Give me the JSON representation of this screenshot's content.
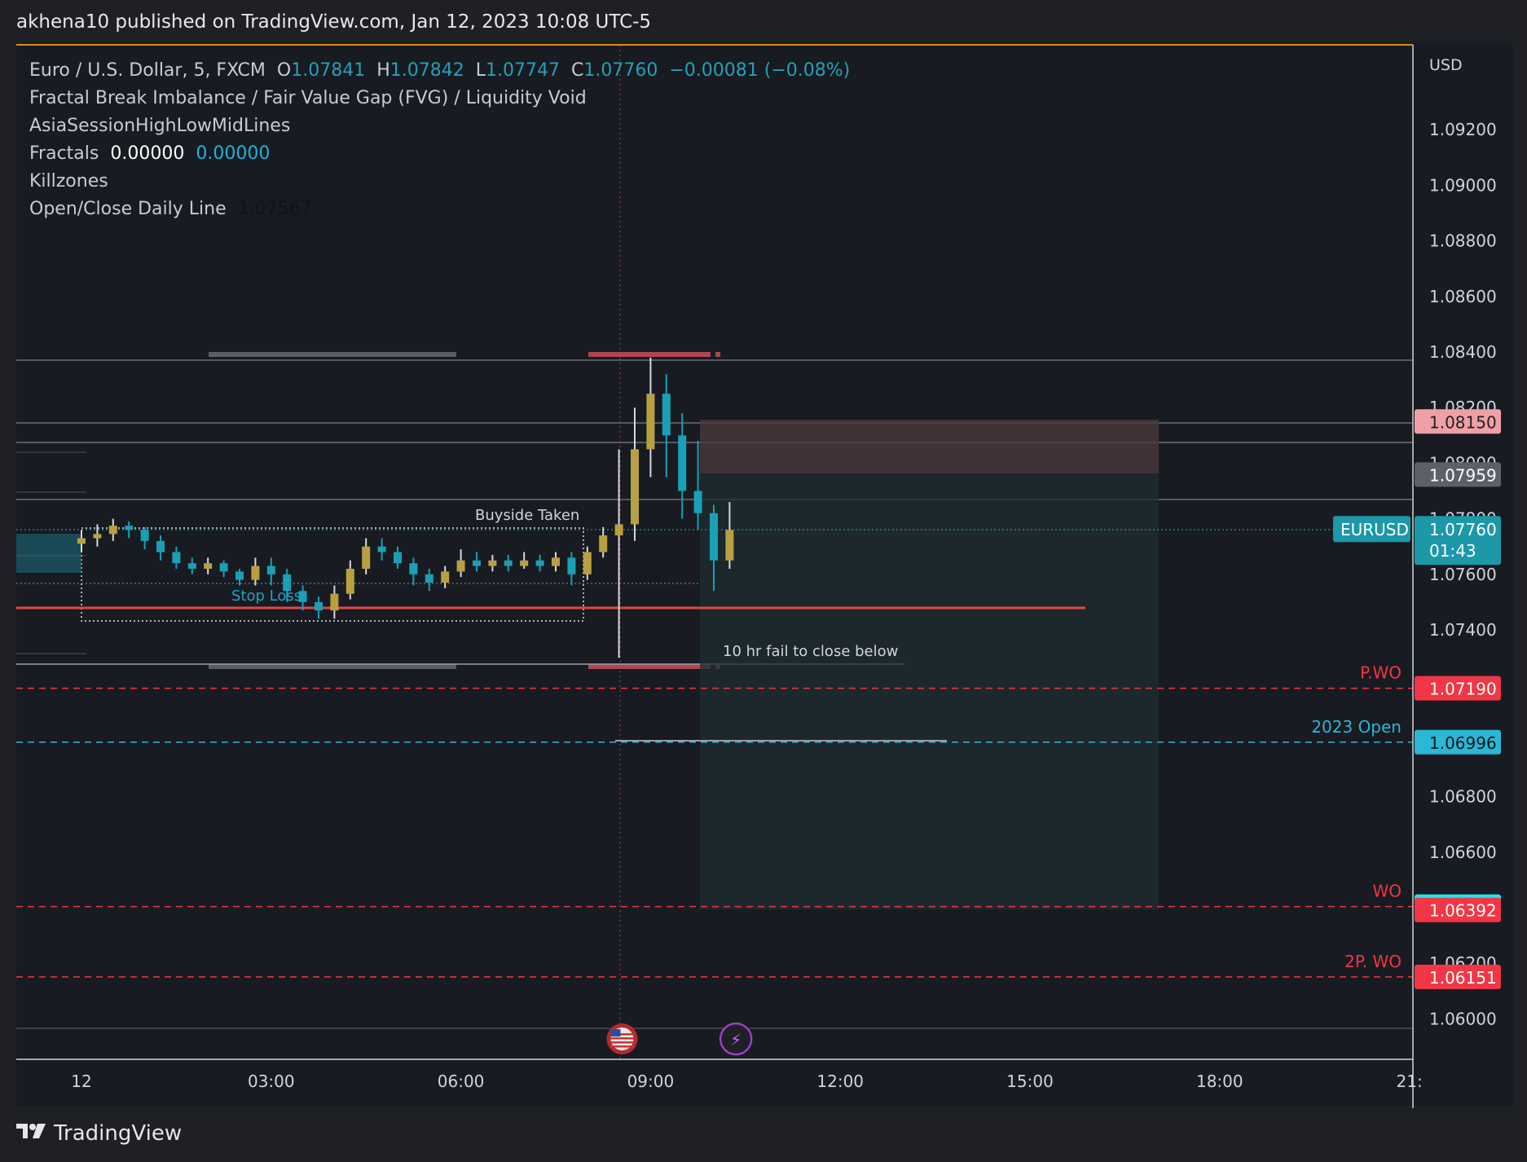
{
  "header": {
    "publish_text": "akhena10 published on TradingView.com, Jan 12, 2023 10:08 UTC-5"
  },
  "legend": {
    "symbol": "Euro / U.S. Dollar, 5, FXCM",
    "o_label": "O",
    "o_value": "1.07841",
    "h_label": "H",
    "h_value": "1.07842",
    "l_label": "L",
    "l_value": "1.07747",
    "c_label": "C",
    "c_value": "1.07760",
    "change": "−0.00081 (−0.08%)",
    "indicator_1": "Fractal Break Imbalance / Fair Value Gap (FVG) / Liquidity Void",
    "indicator_2": "AsiaSessionHighLowMidLines",
    "indicator_3_label": "Fractals",
    "indicator_3_v1": "0.00000",
    "indicator_3_v2": "0.00000",
    "indicator_4": "Killzones",
    "indicator_5_label": "Open/Close Daily Line",
    "indicator_5_value": "1.07567"
  },
  "chart_data": {
    "type": "candlestick",
    "symbol": "EURUSD",
    "interval": "5",
    "currency": "USD",
    "y_range": [
      1.059,
      1.095
    ],
    "x_ticks": [
      {
        "label": "12",
        "hour": 0
      },
      {
        "label": "03:00",
        "hour": 3
      },
      {
        "label": "06:00",
        "hour": 6
      },
      {
        "label": "09:00",
        "hour": 9
      },
      {
        "label": "12:00",
        "hour": 12
      },
      {
        "label": "15:00",
        "hour": 15
      },
      {
        "label": "18:00",
        "hour": 18
      },
      {
        "label": "21:",
        "hour": 21
      }
    ],
    "y_ticks": [
      {
        "label": "1.09200",
        "value": 1.092
      },
      {
        "label": "1.09000",
        "value": 1.09
      },
      {
        "label": "1.08800",
        "value": 1.088
      },
      {
        "label": "1.08600",
        "value": 1.086
      },
      {
        "label": "1.08400",
        "value": 1.084
      },
      {
        "label": "1.08200",
        "value": 1.082
      },
      {
        "label": "1.08000",
        "value": 1.08
      },
      {
        "label": "1.07800",
        "value": 1.078
      },
      {
        "label": "1.07600",
        "value": 1.076
      },
      {
        "label": "1.07400",
        "value": 1.074
      },
      {
        "label": "1.06800",
        "value": 1.068
      },
      {
        "label": "1.06600",
        "value": 1.066
      },
      {
        "label": "1.06200",
        "value": 1.062
      },
      {
        "label": "1.06000",
        "value": 1.06
      }
    ],
    "levels": [
      {
        "label": "P.WO",
        "value": 1.0719,
        "price_label": "1.07190",
        "color": "#f23645",
        "style": "dashed"
      },
      {
        "label": "2023 Open",
        "value": 1.06996,
        "price_label": "1.06996",
        "color": "#2bb7d5",
        "style": "dashed"
      },
      {
        "label": "WO",
        "value": 1.06404,
        "price_label": "1.06404",
        "color": "#f23645",
        "style": "dashed"
      },
      {
        "label": "",
        "value": 1.06392,
        "price_label": "1.06392",
        "color": "#f23645",
        "style": "none"
      },
      {
        "label": "2P. WO",
        "value": 1.06151,
        "price_label": "1.06151",
        "color": "#f23645",
        "style": "dashed"
      }
    ],
    "price_badges": [
      {
        "value": 1.0815,
        "label": "1.08150",
        "bg": "#f0a0a4",
        "fg": "#1e2026"
      },
      {
        "value": 1.07959,
        "label": "1.07959",
        "bg": "#5d6068",
        "fg": "#ffffff"
      }
    ],
    "current": {
      "symbol": "EURUSD",
      "price": "1.07760",
      "countdown": "01:43",
      "value": 1.0776,
      "color": "#1c98a8"
    },
    "annotations": [
      {
        "text": "Buyside Taken"
      },
      {
        "text": "Stop Loss"
      },
      {
        "text": "10 hr fail to close below"
      }
    ],
    "candles": [
      {
        "h": 0.0,
        "o": 1.0771,
        "c": 1.0773,
        "hi": 1.0776,
        "lo": 1.0768
      },
      {
        "h": 0.25,
        "o": 1.0773,
        "c": 1.07745,
        "hi": 1.0778,
        "lo": 1.077
      },
      {
        "h": 0.5,
        "o": 1.07745,
        "c": 1.07775,
        "hi": 1.078,
        "lo": 1.0772
      },
      {
        "h": 0.75,
        "o": 1.07775,
        "c": 1.0776,
        "hi": 1.0779,
        "lo": 1.0773
      },
      {
        "h": 1.0,
        "o": 1.0776,
        "c": 1.0772,
        "hi": 1.0777,
        "lo": 1.0769
      },
      {
        "h": 1.25,
        "o": 1.0772,
        "c": 1.0768,
        "hi": 1.0774,
        "lo": 1.0765
      },
      {
        "h": 1.5,
        "o": 1.0768,
        "c": 1.0764,
        "hi": 1.077,
        "lo": 1.0762
      },
      {
        "h": 1.75,
        "o": 1.0764,
        "c": 1.0762,
        "hi": 1.0766,
        "lo": 1.076
      },
      {
        "h": 2.0,
        "o": 1.0762,
        "c": 1.0764,
        "hi": 1.0766,
        "lo": 1.076
      },
      {
        "h": 2.25,
        "o": 1.0764,
        "c": 1.0761,
        "hi": 1.0765,
        "lo": 1.0759
      },
      {
        "h": 2.5,
        "o": 1.0761,
        "c": 1.0758,
        "hi": 1.0762,
        "lo": 1.0756
      },
      {
        "h": 2.75,
        "o": 1.0758,
        "c": 1.0763,
        "hi": 1.0766,
        "lo": 1.0756
      },
      {
        "h": 3.0,
        "o": 1.0763,
        "c": 1.076,
        "hi": 1.0766,
        "lo": 1.0756
      },
      {
        "h": 3.25,
        "o": 1.076,
        "c": 1.0754,
        "hi": 1.0762,
        "lo": 1.075
      },
      {
        "h": 3.5,
        "o": 1.0754,
        "c": 1.075,
        "hi": 1.0756,
        "lo": 1.0747
      },
      {
        "h": 3.75,
        "o": 1.075,
        "c": 1.0747,
        "hi": 1.0752,
        "lo": 1.0744
      },
      {
        "h": 4.0,
        "o": 1.0747,
        "c": 1.0753,
        "hi": 1.0756,
        "lo": 1.0744
      },
      {
        "h": 4.25,
        "o": 1.0753,
        "c": 1.0762,
        "hi": 1.0765,
        "lo": 1.0751
      },
      {
        "h": 4.5,
        "o": 1.0762,
        "c": 1.077,
        "hi": 1.0773,
        "lo": 1.076
      },
      {
        "h": 4.75,
        "o": 1.077,
        "c": 1.0768,
        "hi": 1.0773,
        "lo": 1.0765
      },
      {
        "h": 5.0,
        "o": 1.0768,
        "c": 1.0764,
        "hi": 1.077,
        "lo": 1.0762
      },
      {
        "h": 5.25,
        "o": 1.0764,
        "c": 1.076,
        "hi": 1.0766,
        "lo": 1.0756
      },
      {
        "h": 5.5,
        "o": 1.076,
        "c": 1.0757,
        "hi": 1.0762,
        "lo": 1.0754
      },
      {
        "h": 5.75,
        "o": 1.0757,
        "c": 1.0761,
        "hi": 1.0763,
        "lo": 1.0755
      },
      {
        "h": 6.0,
        "o": 1.0761,
        "c": 1.0765,
        "hi": 1.0769,
        "lo": 1.0759
      },
      {
        "h": 6.25,
        "o": 1.0765,
        "c": 1.0763,
        "hi": 1.0768,
        "lo": 1.0761
      },
      {
        "h": 6.5,
        "o": 1.0763,
        "c": 1.0765,
        "hi": 1.0767,
        "lo": 1.0761
      },
      {
        "h": 6.75,
        "o": 1.0765,
        "c": 1.0763,
        "hi": 1.0767,
        "lo": 1.0761
      },
      {
        "h": 7.0,
        "o": 1.0763,
        "c": 1.0765,
        "hi": 1.0768,
        "lo": 1.0762
      },
      {
        "h": 7.25,
        "o": 1.0765,
        "c": 1.0763,
        "hi": 1.0767,
        "lo": 1.0761
      },
      {
        "h": 7.5,
        "o": 1.0763,
        "c": 1.0766,
        "hi": 1.0768,
        "lo": 1.0761
      },
      {
        "h": 7.75,
        "o": 1.0766,
        "c": 1.076,
        "hi": 1.0768,
        "lo": 1.0756
      },
      {
        "h": 8.0,
        "o": 1.076,
        "c": 1.0768,
        "hi": 1.077,
        "lo": 1.0758
      },
      {
        "h": 8.25,
        "o": 1.0768,
        "c": 1.0774,
        "hi": 1.0777,
        "lo": 1.0766
      },
      {
        "h": 8.5,
        "o": 1.0774,
        "c": 1.0778,
        "hi": 1.0805,
        "lo": 1.073
      },
      {
        "h": 8.75,
        "o": 1.0778,
        "c": 1.0805,
        "hi": 1.082,
        "lo": 1.0772
      },
      {
        "h": 9.0,
        "o": 1.0805,
        "c": 1.0825,
        "hi": 1.0838,
        "lo": 1.0795
      },
      {
        "h": 9.25,
        "o": 1.0825,
        "c": 1.081,
        "hi": 1.0832,
        "lo": 1.0795
      },
      {
        "h": 9.5,
        "o": 1.081,
        "c": 1.079,
        "hi": 1.0818,
        "lo": 1.078
      },
      {
        "h": 9.75,
        "o": 1.079,
        "c": 1.0782,
        "hi": 1.0808,
        "lo": 1.0776
      },
      {
        "h": 10.0,
        "o": 1.0782,
        "c": 1.0765,
        "hi": 1.0785,
        "lo": 1.0754
      },
      {
        "h": 10.25,
        "o": 1.0765,
        "c": 1.0776,
        "hi": 1.0786,
        "lo": 1.0762
      }
    ],
    "volume_events": [
      {
        "hour": 8.55,
        "icon": "us-flag-icon"
      },
      {
        "hour": 10.35,
        "icon": "lightning-icon"
      }
    ]
  }
}
